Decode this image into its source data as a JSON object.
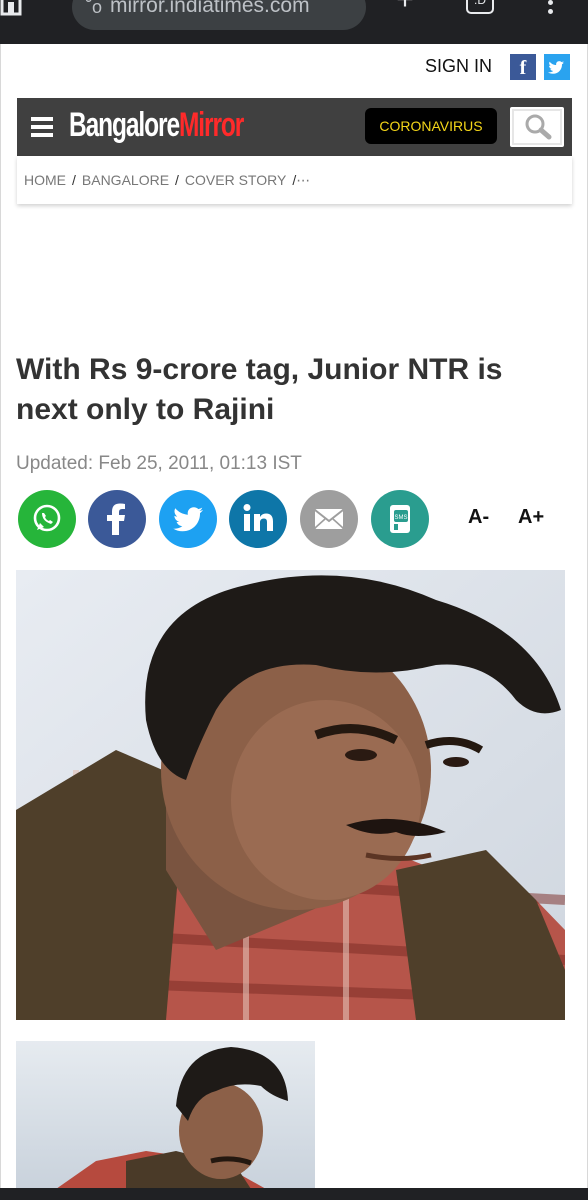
{
  "browser": {
    "url": "mirror.indiatimes.com",
    "tab_count": ":D",
    "icons": [
      "home-icon",
      "site-settings-icon",
      "new-tab-icon",
      "tab-switcher-icon",
      "more-vert-icon"
    ]
  },
  "topbar": {
    "signin_label": "SIGN IN",
    "facebook_glyph": "f"
  },
  "masthead": {
    "logo_part1": "Bangalore",
    "logo_part2": "Mirror",
    "corona_label": "CORONAVIRUS",
    "colors": {
      "background": "#404040",
      "logo_accent": "#ff2a2a",
      "corona_text": "#f4d619"
    }
  },
  "breadcrumb": {
    "items": [
      "HOME",
      "BANGALORE",
      "COVER STORY"
    ],
    "separator": "/",
    "ellipsis": "⋯"
  },
  "article": {
    "headline": "With Rs 9-crore tag, Junior NTR is next only to Rajini",
    "updated": "Updated: Feb 25, 2011, 01:13 IST"
  },
  "share": {
    "buttons": [
      {
        "name": "whatsapp",
        "color": "#26b53a"
      },
      {
        "name": "facebook",
        "color": "#3b5998"
      },
      {
        "name": "twitter",
        "color": "#1da1f2"
      },
      {
        "name": "linkedin",
        "color": "#0e76a8"
      },
      {
        "name": "email",
        "color": "#9e9e9e"
      },
      {
        "name": "sms",
        "color": "#2a9d8f"
      }
    ],
    "font_decrease": "A-",
    "font_increase": "A+"
  }
}
